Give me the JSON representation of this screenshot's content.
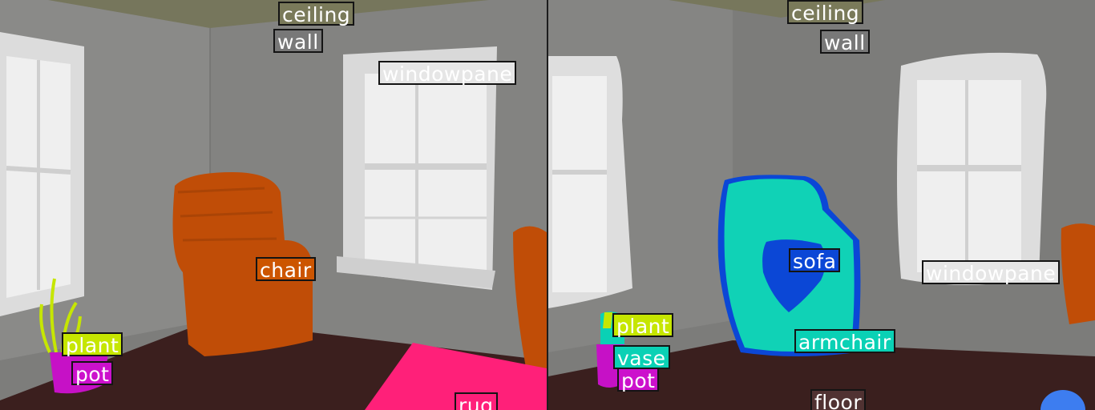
{
  "left_panel": {
    "labels": [
      {
        "id": "ceiling",
        "text": "ceiling",
        "color": "#7a7a5a",
        "text_color": "#ffffff"
      },
      {
        "id": "wall",
        "text": "wall",
        "color": "#787878",
        "text_color": "#ffffff"
      },
      {
        "id": "windowpane",
        "text": "windowpane",
        "color": "#e6e6e6",
        "text_color": "#ffffff"
      },
      {
        "id": "chair",
        "text": "chair",
        "color": "#cc5500",
        "text_color": "#ffffff"
      },
      {
        "id": "plant",
        "text": "plant",
        "color": "#c6e600",
        "text_color": "#ffffff"
      },
      {
        "id": "pot",
        "text": "pot",
        "color": "#cc11cc",
        "text_color": "#ffffff"
      },
      {
        "id": "rug",
        "text": "rug",
        "color": "#ff1f7a",
        "text_color": "#ffffff"
      }
    ]
  },
  "right_panel": {
    "labels": [
      {
        "id": "ceiling",
        "text": "ceiling",
        "color": "#7a7a5a",
        "text_color": "#ffffff"
      },
      {
        "id": "wall",
        "text": "wall",
        "color": "#787878",
        "text_color": "#ffffff"
      },
      {
        "id": "sofa",
        "text": "sofa",
        "color": "#0b47d6",
        "text_color": "#ffffff"
      },
      {
        "id": "windowpane",
        "text": "windowpane",
        "color": "#e6e6e6",
        "text_color": "#ffffff"
      },
      {
        "id": "plant",
        "text": "plant",
        "color": "#c6e600",
        "text_color": "#ffffff"
      },
      {
        "id": "vase",
        "text": "vase",
        "color": "#0ad1b5",
        "text_color": "#ffffff"
      },
      {
        "id": "armchair",
        "text": "armchair",
        "color": "#0ad1b5",
        "text_color": "#ffffff"
      },
      {
        "id": "pot",
        "text": "pot",
        "color": "#cc11cc",
        "text_color": "#ffffff"
      },
      {
        "id": "floor",
        "text": "floor",
        "color": "#503232",
        "text_color": "#ffffff"
      }
    ]
  }
}
